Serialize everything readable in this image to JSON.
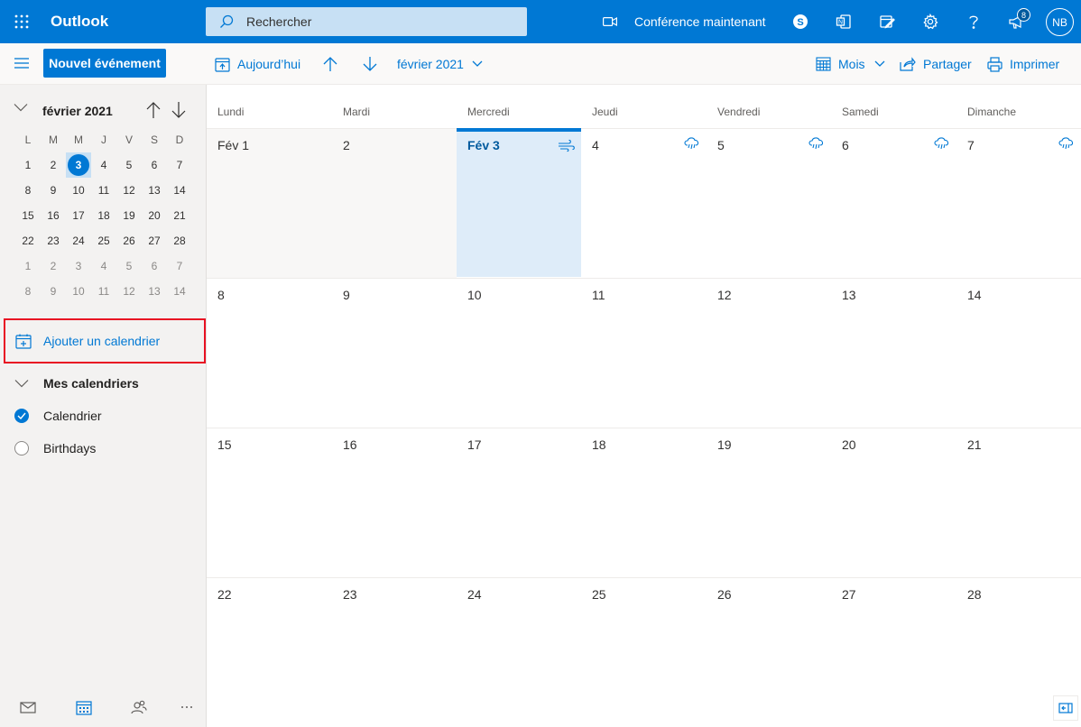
{
  "app": {
    "brand": "Outlook"
  },
  "search": {
    "placeholder": "Rechercher"
  },
  "header": {
    "meet_now": "Conférence maintenant",
    "notifications_count": "8",
    "avatar_initials": "NB"
  },
  "commandbar": {
    "new_event": "Nouvel événement",
    "today": "Aujourd’hui",
    "month_label": "février 2021",
    "view": "Mois",
    "share": "Partager",
    "print": "Imprimer"
  },
  "mini_calendar": {
    "title": "février 2021",
    "weekdays": [
      "L",
      "M",
      "M",
      "J",
      "V",
      "S",
      "D"
    ],
    "weeks": [
      [
        "1",
        "2",
        "3",
        "4",
        "5",
        "6",
        "7"
      ],
      [
        "8",
        "9",
        "10",
        "11",
        "12",
        "13",
        "14"
      ],
      [
        "15",
        "16",
        "17",
        "18",
        "19",
        "20",
        "21"
      ],
      [
        "22",
        "23",
        "24",
        "25",
        "26",
        "27",
        "28"
      ],
      [
        "1",
        "2",
        "3",
        "4",
        "5",
        "6",
        "7"
      ],
      [
        "8",
        "9",
        "10",
        "11",
        "12",
        "13",
        "14"
      ]
    ],
    "today": "3"
  },
  "sidebar": {
    "add_calendar": "Ajouter un calendrier",
    "my_calendars": "Mes calendriers",
    "calendars": [
      {
        "label": "Calendrier",
        "checked": true
      },
      {
        "label": "Birthdays",
        "checked": false
      }
    ]
  },
  "month_view": {
    "weekdays": [
      "Lundi",
      "Mardi",
      "Mercredi",
      "Jeudi",
      "Vendredi",
      "Samedi",
      "Dimanche"
    ],
    "weeks": [
      [
        "Fév 1",
        "2",
        "Fév 3",
        "4",
        "5",
        "6",
        "7"
      ],
      [
        "8",
        "9",
        "10",
        "11",
        "12",
        "13",
        "14"
      ],
      [
        "15",
        "16",
        "17",
        "18",
        "19",
        "20",
        "21"
      ],
      [
        "22",
        "23",
        "24",
        "25",
        "26",
        "27",
        "28"
      ]
    ],
    "weather_icons": [
      "",
      "",
      "wind-icon",
      "rain-cloud-icon",
      "rain-cloud-icon",
      "rain-cloud-icon",
      "rain-cloud-icon"
    ]
  },
  "colors": {
    "accent": "#0078d4",
    "highlight_border": "#e81123",
    "today_bg": "#deecf9"
  }
}
